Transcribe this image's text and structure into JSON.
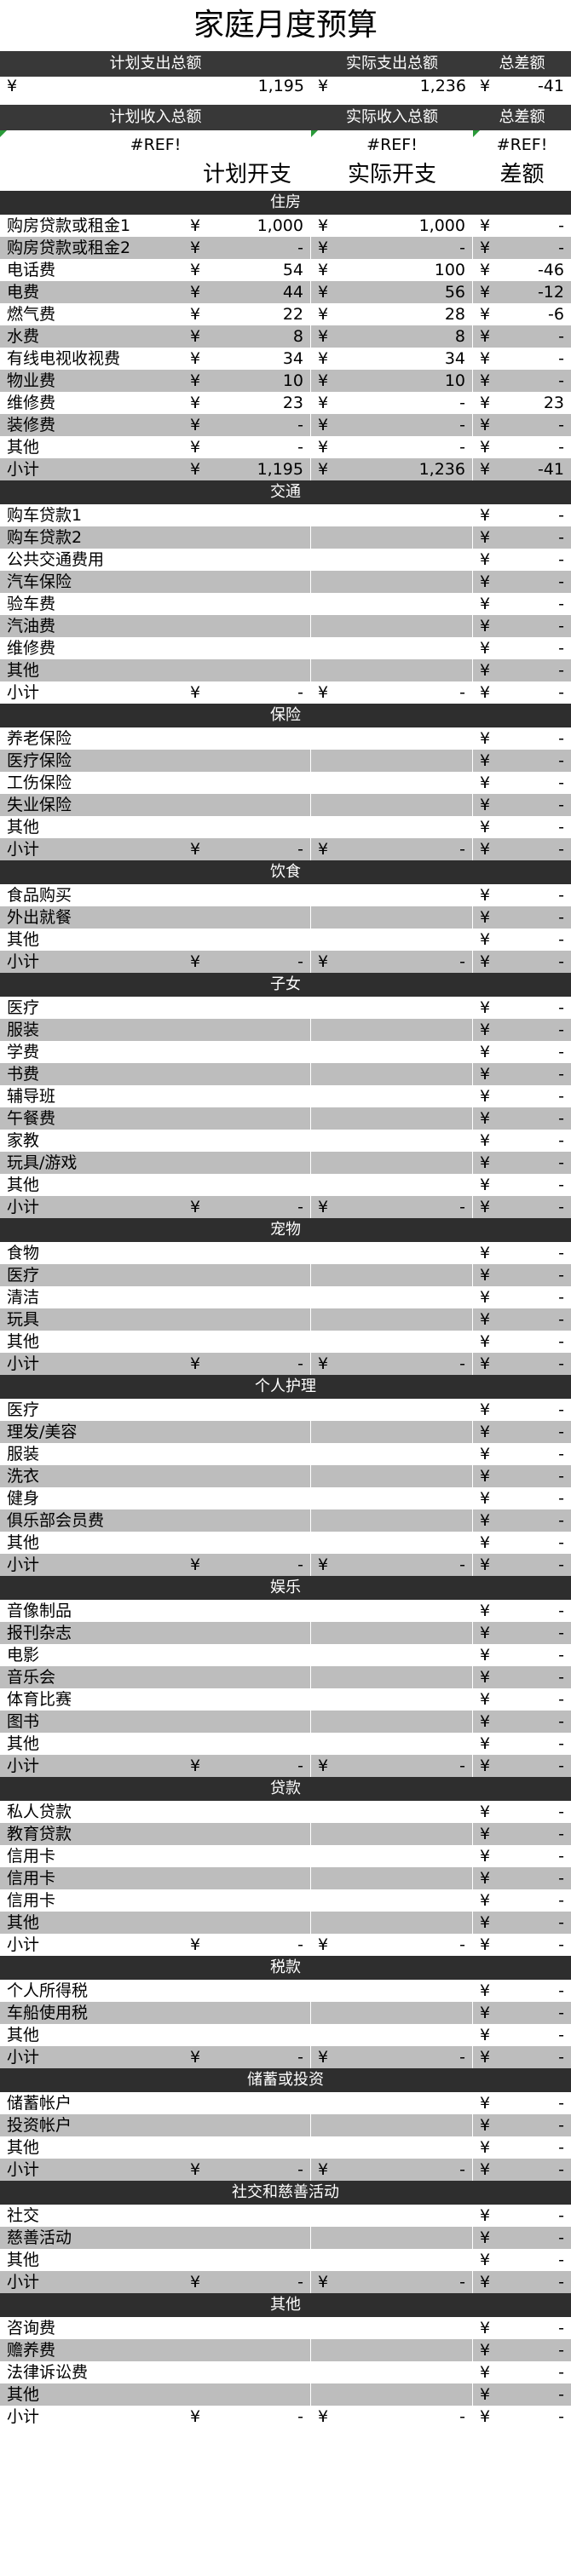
{
  "title": "家庭月度预算",
  "currency": "¥",
  "summary": {
    "planned_expense_label": "计划支出总额",
    "actual_expense_label": "实际支出总额",
    "diff_label": "总差额",
    "planned_expense": "1,195",
    "actual_expense": "1,236",
    "diff": "-41",
    "planned_income_label": "计划收入总额",
    "actual_income_label": "实际收入总额",
    "income_diff_label": "总差额",
    "planned_income": "#REF!",
    "actual_income": "#REF!",
    "income_diff": "#REF!"
  },
  "columns": {
    "planned": "计划开支",
    "actual": "实际开支",
    "diff": "差额"
  },
  "sections": [
    {
      "title": "住房",
      "rows": [
        {
          "label": "购房贷款或租金1",
          "planned": "1,000",
          "actual": "1,000",
          "diff": "-"
        },
        {
          "label": "购房贷款或租金2",
          "planned": "-",
          "actual": "-",
          "diff": "-"
        },
        {
          "label": "电话费",
          "planned": "54",
          "actual": "100",
          "diff": "-46"
        },
        {
          "label": "电费",
          "planned": "44",
          "actual": "56",
          "diff": "-12"
        },
        {
          "label": "燃气费",
          "planned": "22",
          "actual": "28",
          "diff": "-6"
        },
        {
          "label": "水费",
          "planned": "8",
          "actual": "8",
          "diff": "-"
        },
        {
          "label": "有线电视收视费",
          "planned": "34",
          "actual": "34",
          "diff": "-"
        },
        {
          "label": "物业费",
          "planned": "10",
          "actual": "10",
          "diff": "-"
        },
        {
          "label": "维修费",
          "planned": "23",
          "actual": "-",
          "diff": "23"
        },
        {
          "label": "装修费",
          "planned": "-",
          "actual": "-",
          "diff": "-"
        },
        {
          "label": "其他",
          "planned": "-",
          "actual": "-",
          "diff": "-"
        },
        {
          "label": "小计",
          "planned": "1,195",
          "actual": "1,236",
          "diff": "-41",
          "subtotal": true
        }
      ]
    },
    {
      "title": "交通",
      "rows": [
        {
          "label": "购车贷款1",
          "planned": "",
          "actual": "",
          "diff": "-"
        },
        {
          "label": "购车贷款2",
          "planned": "",
          "actual": "",
          "diff": "-"
        },
        {
          "label": "公共交通费用",
          "planned": "",
          "actual": "",
          "diff": "-"
        },
        {
          "label": "汽车保险",
          "planned": "",
          "actual": "",
          "diff": "-"
        },
        {
          "label": "验车费",
          "planned": "",
          "actual": "",
          "diff": "-"
        },
        {
          "label": "汽油费",
          "planned": "",
          "actual": "",
          "diff": "-"
        },
        {
          "label": "维修费",
          "planned": "",
          "actual": "",
          "diff": "-"
        },
        {
          "label": "其他",
          "planned": "",
          "actual": "",
          "diff": "-"
        },
        {
          "label": "小计",
          "planned": "-",
          "actual": "-",
          "diff": "-",
          "subtotal": true
        }
      ]
    },
    {
      "title": "保险",
      "rows": [
        {
          "label": "养老保险",
          "planned": "",
          "actual": "",
          "diff": "-"
        },
        {
          "label": "医疗保险",
          "planned": "",
          "actual": "",
          "diff": "-"
        },
        {
          "label": "工伤保险",
          "planned": "",
          "actual": "",
          "diff": "-"
        },
        {
          "label": "失业保险",
          "planned": "",
          "actual": "",
          "diff": "-"
        },
        {
          "label": "其他",
          "planned": "",
          "actual": "",
          "diff": "-"
        },
        {
          "label": "小计",
          "planned": "-",
          "actual": "-",
          "diff": "-",
          "subtotal": true
        }
      ]
    },
    {
      "title": "饮食",
      "rows": [
        {
          "label": "食品购买",
          "planned": "",
          "actual": "",
          "diff": "-"
        },
        {
          "label": "外出就餐",
          "planned": "",
          "actual": "",
          "diff": "-"
        },
        {
          "label": "其他",
          "planned": "",
          "actual": "",
          "diff": "-"
        },
        {
          "label": "小计",
          "planned": "-",
          "actual": "-",
          "diff": "-",
          "subtotal": true
        }
      ]
    },
    {
      "title": "子女",
      "rows": [
        {
          "label": "医疗",
          "planned": "",
          "actual": "",
          "diff": "-"
        },
        {
          "label": "服装",
          "planned": "",
          "actual": "",
          "diff": "-"
        },
        {
          "label": "学费",
          "planned": "",
          "actual": "",
          "diff": "-"
        },
        {
          "label": "书费",
          "planned": "",
          "actual": "",
          "diff": "-"
        },
        {
          "label": "辅导班",
          "planned": "",
          "actual": "",
          "diff": "-"
        },
        {
          "label": "午餐费",
          "planned": "",
          "actual": "",
          "diff": "-"
        },
        {
          "label": "家教",
          "planned": "",
          "actual": "",
          "diff": "-"
        },
        {
          "label": "玩具/游戏",
          "planned": "",
          "actual": "",
          "diff": "-"
        },
        {
          "label": "其他",
          "planned": "",
          "actual": "",
          "diff": "-"
        },
        {
          "label": "小计",
          "planned": "-",
          "actual": "-",
          "diff": "-",
          "subtotal": true
        }
      ]
    },
    {
      "title": "宠物",
      "rows": [
        {
          "label": "食物",
          "planned": "",
          "actual": "",
          "diff": "-"
        },
        {
          "label": "医疗",
          "planned": "",
          "actual": "",
          "diff": "-"
        },
        {
          "label": "清洁",
          "planned": "",
          "actual": "",
          "diff": "-"
        },
        {
          "label": "玩具",
          "planned": "",
          "actual": "",
          "diff": "-"
        },
        {
          "label": "其他",
          "planned": "",
          "actual": "",
          "diff": "-"
        },
        {
          "label": "小计",
          "planned": "-",
          "actual": "-",
          "diff": "-",
          "subtotal": true
        }
      ]
    },
    {
      "title": "个人护理",
      "rows": [
        {
          "label": "医疗",
          "planned": "",
          "actual": "",
          "diff": "-"
        },
        {
          "label": "理发/美容",
          "planned": "",
          "actual": "",
          "diff": "-"
        },
        {
          "label": "服装",
          "planned": "",
          "actual": "",
          "diff": "-"
        },
        {
          "label": "洗衣",
          "planned": "",
          "actual": "",
          "diff": "-"
        },
        {
          "label": "健身",
          "planned": "",
          "actual": "",
          "diff": "-"
        },
        {
          "label": "俱乐部会员费",
          "planned": "",
          "actual": "",
          "diff": "-"
        },
        {
          "label": "其他",
          "planned": "",
          "actual": "",
          "diff": "-"
        },
        {
          "label": "小计",
          "planned": "-",
          "actual": "-",
          "diff": "-",
          "subtotal": true
        }
      ]
    },
    {
      "title": "娱乐",
      "rows": [
        {
          "label": "音像制品",
          "planned": "",
          "actual": "",
          "diff": "-"
        },
        {
          "label": "报刊杂志",
          "planned": "",
          "actual": "",
          "diff": "-"
        },
        {
          "label": "电影",
          "planned": "",
          "actual": "",
          "diff": "-"
        },
        {
          "label": "音乐会",
          "planned": "",
          "actual": "",
          "diff": "-"
        },
        {
          "label": "体育比赛",
          "planned": "",
          "actual": "",
          "diff": "-"
        },
        {
          "label": "图书",
          "planned": "",
          "actual": "",
          "diff": "-"
        },
        {
          "label": "其他",
          "planned": "",
          "actual": "",
          "diff": "-"
        },
        {
          "label": "小计",
          "planned": "-",
          "actual": "-",
          "diff": "-",
          "subtotal": true
        }
      ]
    },
    {
      "title": "贷款",
      "rows": [
        {
          "label": "私人贷款",
          "planned": "",
          "actual": "",
          "diff": "-"
        },
        {
          "label": "教育贷款",
          "planned": "",
          "actual": "",
          "diff": "-"
        },
        {
          "label": "信用卡",
          "planned": "",
          "actual": "",
          "diff": "-"
        },
        {
          "label": "信用卡",
          "planned": "",
          "actual": "",
          "diff": "-"
        },
        {
          "label": "信用卡",
          "planned": "",
          "actual": "",
          "diff": "-"
        },
        {
          "label": "其他",
          "planned": "",
          "actual": "",
          "diff": "-"
        },
        {
          "label": "小计",
          "planned": "-",
          "actual": "-",
          "diff": "-",
          "subtotal": true
        }
      ]
    },
    {
      "title": "税款",
      "rows": [
        {
          "label": "个人所得税",
          "planned": "",
          "actual": "",
          "diff": "-"
        },
        {
          "label": "车船使用税",
          "planned": "",
          "actual": "",
          "diff": "-"
        },
        {
          "label": "其他",
          "planned": "",
          "actual": "",
          "diff": "-"
        },
        {
          "label": "小计",
          "planned": "-",
          "actual": "-",
          "diff": "-",
          "subtotal": true
        }
      ]
    },
    {
      "title": "储蓄或投资",
      "rows": [
        {
          "label": "储蓄帐户",
          "planned": "",
          "actual": "",
          "diff": "-"
        },
        {
          "label": "投资帐户",
          "planned": "",
          "actual": "",
          "diff": "-"
        },
        {
          "label": "其他",
          "planned": "",
          "actual": "",
          "diff": "-"
        },
        {
          "label": "小计",
          "planned": "-",
          "actual": "-",
          "diff": "-",
          "subtotal": true
        }
      ]
    },
    {
      "title": "社交和慈善活动",
      "rows": [
        {
          "label": "社交",
          "planned": "",
          "actual": "",
          "diff": "-"
        },
        {
          "label": "慈善活动",
          "planned": "",
          "actual": "",
          "diff": "-"
        },
        {
          "label": "其他",
          "planned": "",
          "actual": "",
          "diff": "-"
        },
        {
          "label": "小计",
          "planned": "-",
          "actual": "-",
          "diff": "-",
          "subtotal": true
        }
      ]
    },
    {
      "title": "其他",
      "rows": [
        {
          "label": "咨询费",
          "planned": "",
          "actual": "",
          "diff": "-"
        },
        {
          "label": "赡养费",
          "planned": "",
          "actual": "",
          "diff": "-"
        },
        {
          "label": "法律诉讼费",
          "planned": "",
          "actual": "",
          "diff": "-"
        },
        {
          "label": "其他",
          "planned": "",
          "actual": "",
          "diff": "-"
        },
        {
          "label": "小计",
          "planned": "-",
          "actual": "-",
          "diff": "-",
          "subtotal": true
        }
      ]
    }
  ]
}
